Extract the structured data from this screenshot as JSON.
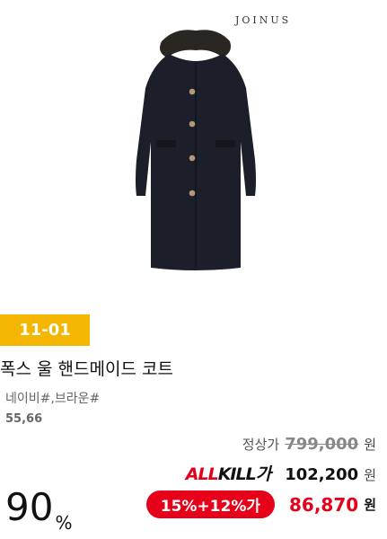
{
  "brand": "JOINUS",
  "badge": {
    "date": "11-01"
  },
  "product": {
    "title": "폭스 울 핸드메이드 코트",
    "colors": "네이비#,브라운#",
    "sizes": "55,66"
  },
  "pricing": {
    "regular_label": "정상가",
    "regular_price": "799,000",
    "won": "원",
    "allkill_logo_a": "ALL",
    "allkill_logo_b": "KILL가",
    "allkill_price": "102,200",
    "coupon": "15%+12%가",
    "final_price": "86,870",
    "discount_rate": "90",
    "discount_unit": "%"
  },
  "colors": {
    "badge": "#f5b600",
    "accent_red": "#e60019",
    "coat": "#1c1f2a"
  },
  "icons": {
    "product_image": "coat-image"
  }
}
